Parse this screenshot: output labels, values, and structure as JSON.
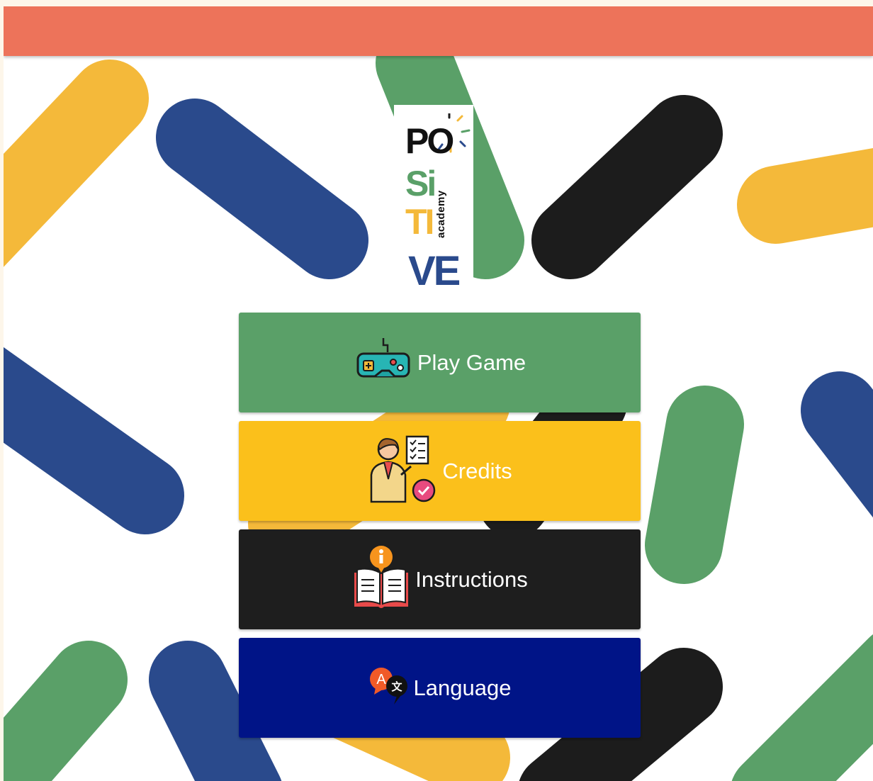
{
  "logo": {
    "line1": "PO",
    "line2": "Si",
    "line3": "TI",
    "line4": "VE",
    "tagline": "academy"
  },
  "menu": {
    "items": [
      {
        "label": "Play Game",
        "icon": "gamepad-icon",
        "color": "#5aa068"
      },
      {
        "label": "Credits",
        "icon": "teacher-checklist-icon",
        "color": "#fbc01b"
      },
      {
        "label": "Instructions",
        "icon": "book-info-icon",
        "color": "#1e1e1e"
      },
      {
        "label": "Language",
        "icon": "translate-icon",
        "color": "#001487"
      }
    ]
  },
  "colors": {
    "topbar": "#ed735a",
    "green": "#5aa068",
    "yellow": "#f4b93a",
    "blue": "#2a4a8c",
    "black": "#1c1c1c"
  }
}
